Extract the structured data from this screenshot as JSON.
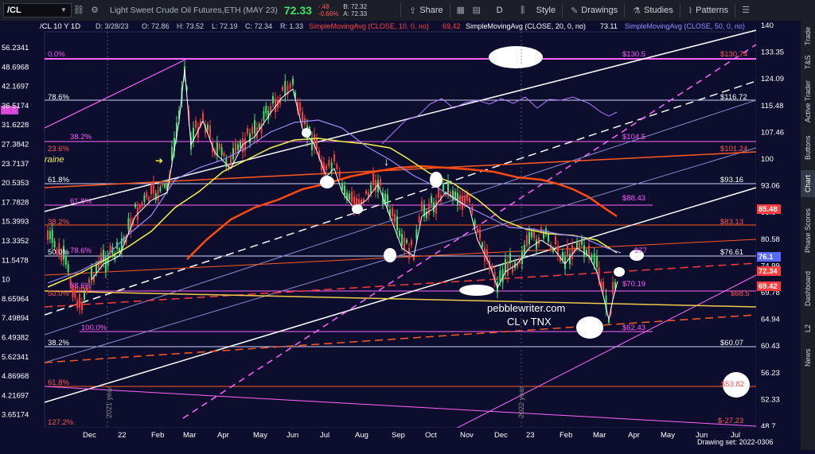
{
  "toolbar": {
    "symbol": "/CL",
    "description": "Light Sweet Crude Oil Futures,ETH (MAY 23)",
    "last": "72.33",
    "change": "-.48",
    "change_pct": "-0.66%",
    "bid": "B: 72.32",
    "ask": "A: 72.33",
    "share": "Share",
    "period": "D",
    "style": "Style",
    "drawings": "Drawings",
    "studies": "Studies",
    "patterns": "Patterns"
  },
  "chart_header": {
    "title": "/CL 10 Y 1D",
    "date": "D: 3/28/23",
    "open": "O: 72.86",
    "high": "H: 73.52",
    "low": "L: 72.19",
    "close": "C: 72.34",
    "ratio": "R: 1.33",
    "sma10": "SimpleMovingAvg (CLOSE, 10, 0, no)",
    "sma10_val": "69.42",
    "sma20": "SimpleMovingAvg (CLOSE, 20, 0, no)",
    "sma20_val": "73.11",
    "sma50": "SimpleMovingAvg (CLOSE, 50, 0, no)"
  },
  "colors": {
    "background": "#0d0d2e",
    "sma10": "#ff4040",
    "sma20": "#ffffff",
    "sma50": "#9a8cff",
    "fib_magenta": "#ff55ff",
    "orange": "#ff5a1f",
    "yellow": "#f2f24a",
    "last_green": "#3de36b"
  },
  "annotations": {
    "watermark_line1": "pebblewriter.com",
    "watermark_line2": "CL v TNX",
    "raine": "raine",
    "year_2021": "2021 year",
    "year_2022": "2022 year",
    "drawing_set": "Drawing set: 2022-0306"
  },
  "left_axis": [
    "56.2341",
    "48.6968",
    "42.1697",
    "36.5174",
    "31.6228",
    "27.3842",
    "23.7137",
    "20.5353",
    "17.7828",
    "15.3993",
    "13.3352",
    "11.5478",
    "10",
    "8.65964",
    "7.49894",
    "6.49382",
    "5.62341",
    "4.86968",
    "4.21697",
    "3.65174"
  ],
  "right_axis": [
    "140",
    "133.35",
    "124.09",
    "115.48",
    "107.46",
    "100",
    "93.06",
    "86.6",
    "80.58",
    "74.99",
    "69.78",
    "64.94",
    "60.43",
    "56.23",
    "52.33",
    "48.7"
  ],
  "right_tags": [
    {
      "text": "85.48",
      "color": "#ff3b3b"
    },
    {
      "text": "76.1",
      "color": "#5a6cff"
    },
    {
      "text": "72.34",
      "color": "#ff3b3b"
    },
    {
      "text": "69.42",
      "color": "#ff3b3b"
    }
  ],
  "fib_labels": [
    {
      "text": "0.0%",
      "color": "#ff55ff"
    },
    {
      "text": "78.6%",
      "color": "#ffffff"
    },
    {
      "text": "38.2%",
      "color": "#ff55ff"
    },
    {
      "text": "23.6%",
      "color": "#ff5555"
    },
    {
      "text": "61.8%",
      "color": "#ffffff"
    },
    {
      "text": "61.8%",
      "color": "#ff55ff"
    },
    {
      "text": "38.2%",
      "color": "#ff5555"
    },
    {
      "text": "50.0%",
      "color": "#ffffff"
    },
    {
      "text": "78.6%",
      "color": "#ff55ff"
    },
    {
      "text": "50.0%",
      "color": "#ff5555"
    },
    {
      "text": "88.6%",
      "color": "#ff55ff"
    },
    {
      "text": "100.0%",
      "color": "#ff55ff"
    },
    {
      "text": "38.2%",
      "color": "#ffffff"
    },
    {
      "text": "61.8%",
      "color": "#ff5555"
    },
    {
      "text": "127.2%",
      "color": "#ff5555"
    },
    {
      "text": "88.6%",
      "color": "#ff5555"
    },
    {
      "text": "35.6",
      "color": "#ff55ff"
    }
  ],
  "price_labels": [
    {
      "text": "$130.5",
      "color": "#ff55ff"
    },
    {
      "text": "$130.74",
      "color": "#ff5555"
    },
    {
      "text": "$116.72",
      "color": "#ffffff"
    },
    {
      "text": "$104.5",
      "color": "#ff55ff"
    },
    {
      "text": "$101.24",
      "color": "#ff5555"
    },
    {
      "text": "$93.16",
      "color": "#ffffff"
    },
    {
      "text": "$88.43",
      "color": "#ff55ff"
    },
    {
      "text": "$83.13",
      "color": "#ff5555"
    },
    {
      "text": "$76.61",
      "color": "#ffffff"
    },
    {
      "text": "$77",
      "color": "#ff55ff"
    },
    {
      "text": "$70.19",
      "color": "#ff55ff"
    },
    {
      "text": "$68.5",
      "color": "#ff5555"
    },
    {
      "text": "$62.43",
      "color": "#ff55ff"
    },
    {
      "text": "$60.07",
      "color": "#ffffff"
    },
    {
      "text": "$53.82",
      "color": "#ff5555"
    },
    {
      "text": "$-27.23",
      "color": "#ff5555"
    }
  ],
  "x_axis": [
    "Dec",
    "22",
    "Feb",
    "Mar",
    "Apr",
    "May",
    "Jun",
    "Jul",
    "Aug",
    "Sep",
    "Oct",
    "Nov",
    "Dec",
    "23",
    "Feb",
    "Mar",
    "Apr",
    "May",
    "Jun",
    "Jul"
  ],
  "right_sidebar": [
    "Trade",
    "T&S",
    "Active Trader",
    "Buttons",
    "Chart",
    "Phase Scores",
    "Dashboard",
    "L2",
    "News"
  ]
}
